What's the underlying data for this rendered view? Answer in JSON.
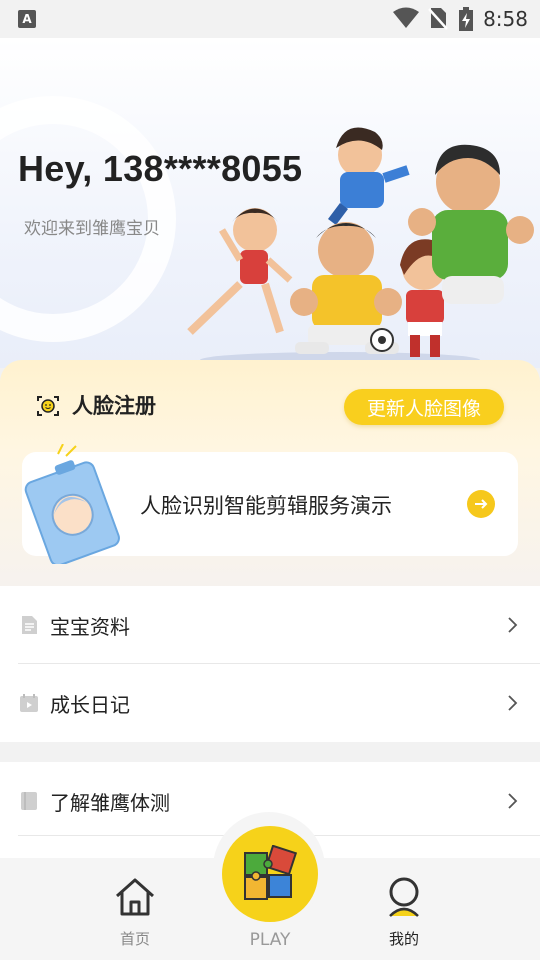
{
  "status_bar": {
    "time": "8:58",
    "notification_icon_text": "A"
  },
  "header": {
    "greeting": "Hey, 138****8055",
    "subtitle": "欢迎来到雏鹰宝贝"
  },
  "face_section": {
    "title": "人脸注册",
    "update_button": "更新人脸图像",
    "demo_text": "人脸识别智能剪辑服务演示"
  },
  "menu_group_1": [
    {
      "label": "宝宝资料",
      "icon": "document-icon"
    },
    {
      "label": "成长日记",
      "icon": "calendar-icon"
    }
  ],
  "menu_group_2": [
    {
      "label": "了解雏鹰体测",
      "icon": "book-icon"
    }
  ],
  "tab_bar": {
    "home_label": "首页",
    "play_label": "PLAY",
    "mine_label": "我的"
  },
  "colors": {
    "accent": "#f6d21a",
    "button": "#f9cf1e"
  }
}
